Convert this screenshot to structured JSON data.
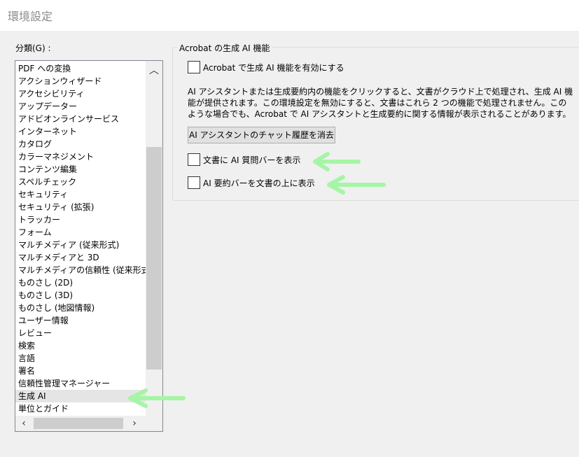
{
  "window": {
    "title": "環境設定"
  },
  "categories": {
    "label": "分類(G) :",
    "items": [
      "PDF への変換",
      "アクションウィザード",
      "アクセシビリティ",
      "アップデーター",
      "アドビオンラインサービス",
      "インターネット",
      "カタログ",
      "カラーマネジメント",
      "コンテンツ編集",
      "スペルチェック",
      "セキュリティ",
      "セキュリティ (拡張)",
      "トラッカー",
      "フォーム",
      "マルチメディア (従来形式)",
      "マルチメディアと 3D",
      "マルチメディアの信頼性 (従来形式)",
      "ものさし (2D)",
      "ものさし (3D)",
      "ものさし (地図情報)",
      "ユーザー情報",
      "レビュー",
      "検索",
      "言語",
      "署名",
      "信頼性管理マネージャー",
      "生成 AI",
      "単位とガイド"
    ],
    "selected_index": 26
  },
  "panel": {
    "group_title": "Acrobat の生成 AI 機能",
    "enable_checkbox": {
      "label": "Acrobat で生成 AI 機能を有効にする",
      "checked": false
    },
    "description": "AI アシスタントまたは生成要約内の機能をクリックすると、文書がクラウド上で処理され、生成 AI 機能が提供されます。この環境設定を無効にすると、文書はこれら 2 つの機能で処理されません。このような場合でも、Acrobat で AI アシスタントと生成要約に関する情報が表示されることがあります。",
    "clear_history_button": "AI アシスタントのチャット履歴を消去",
    "question_bar_checkbox": {
      "label": "文書に AI 質問バーを表示",
      "checked": false
    },
    "summary_bar_checkbox": {
      "label": "AI 要約バーを文書の上に表示",
      "checked": false
    }
  },
  "colors": {
    "annotation_arrow": "#a6f5a6",
    "selected_item_bg": "#e5e5e5"
  },
  "icons": [
    "scroll-up-icon",
    "scroll-down-icon",
    "scroll-left-icon",
    "scroll-right-icon",
    "annotation-arrow-icon"
  ]
}
